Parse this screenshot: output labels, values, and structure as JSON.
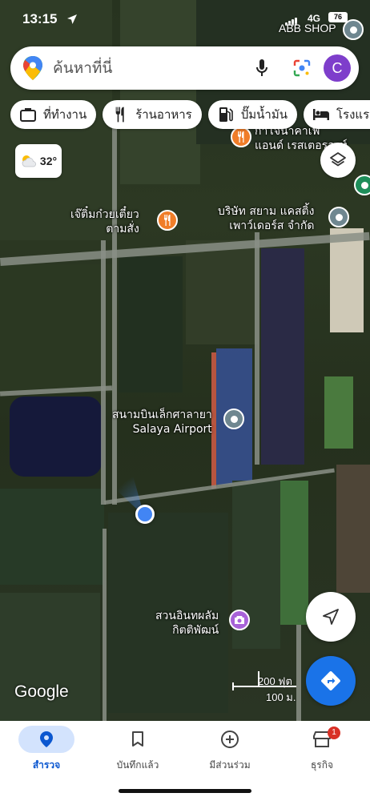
{
  "status_bar": {
    "time": "13:15",
    "network": "4G",
    "battery": "76"
  },
  "top_label": "ABB SHOP",
  "search": {
    "placeholder": "ค้นหาที่นี่",
    "avatar_letter": "C"
  },
  "chips": [
    {
      "label": "ที่ทำงาน",
      "icon": "briefcase-icon"
    },
    {
      "label": "ร้านอาหาร",
      "icon": "restaurant-icon"
    },
    {
      "label": "ปั๊มน้ำมัน",
      "icon": "gas-station-icon"
    },
    {
      "label": "โรงแรม",
      "icon": "hotel-icon"
    }
  ],
  "weather": {
    "temp": "32°",
    "icon": "partly-cloudy-icon"
  },
  "places": {
    "cafe": {
      "line1": "กาโจนาคาเฟ่",
      "line2": "แอนด์ เรสเตอรองท์"
    },
    "noodle": {
      "line1": "เจ๊ติ๋มก๋วยเตี๋ยว",
      "line2": "ตามสั่ง"
    },
    "company": {
      "line1": "บริษัท สยาม แคสติ้ง",
      "line2": "เพาว์เดอร์ส จำกัด"
    },
    "airport": {
      "line1": "สนามบินเล็กศาลายา",
      "line2": "Salaya Airport"
    },
    "park": {
      "line1": "สวนอินทผลัม",
      "line2": "กิตติพัฒน์"
    }
  },
  "map": {
    "google_logo": "Google",
    "scale_ft": "200 ฟุต",
    "scale_m": "100 ม."
  },
  "bottom_nav": [
    {
      "label": "สำรวจ",
      "icon": "explore-pin-icon",
      "active": true
    },
    {
      "label": "บันทึกแล้ว",
      "icon": "bookmark-icon",
      "active": false
    },
    {
      "label": "มีส่วนร่วม",
      "icon": "add-circle-icon",
      "active": false
    },
    {
      "label": "ธุรกิจ",
      "icon": "store-icon",
      "active": false,
      "badge": "1"
    }
  ],
  "colors": {
    "accent_blue": "#1a73e8",
    "nav_active_bg": "#d3e3fd",
    "avatar": "#7e3ecb"
  }
}
